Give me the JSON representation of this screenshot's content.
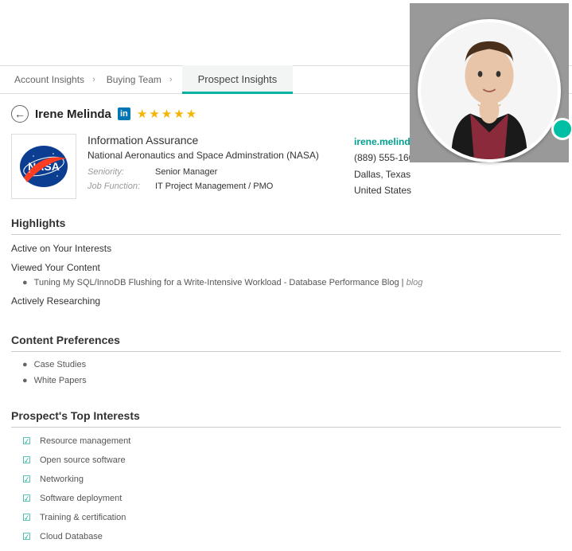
{
  "tabs": {
    "account_insights": "Account Insights",
    "buying_team": "Buying Team",
    "prospect_insights": "Prospect Insights"
  },
  "prospect": {
    "name": "Irene Melinda",
    "title": "Information Assurance",
    "company": "National Aeronautics and Space Adminstration (NASA)",
    "seniority_label": "Seniority:",
    "seniority": "Senior Manager",
    "job_function_label": "Job Function:",
    "job_function": "IT Project Management / PMO",
    "email": "irene.melinda@nasa.com",
    "phone": "(889) 555-1600",
    "city": "Dallas, Texas",
    "country": "United States"
  },
  "sections": {
    "highlights": {
      "title": "Highlights",
      "active": "Active on Your Interests",
      "viewed": "Viewed Your Content",
      "viewed_item": "Tuning My SQL/InnoDB Flushing for a Write-Intensive Workload - Database Performance Blog  |  ",
      "viewed_tag": "blog",
      "researching": "Actively Researching"
    },
    "content_prefs": {
      "title": "Content Preferences",
      "items": [
        "Case Studies",
        "White Papers"
      ]
    },
    "interests": {
      "title": "Prospect's Top Interests",
      "items": [
        "Resource management",
        "Open source software",
        "Networking",
        "Software deployment",
        "Training & certification",
        "Cloud Database"
      ]
    }
  }
}
